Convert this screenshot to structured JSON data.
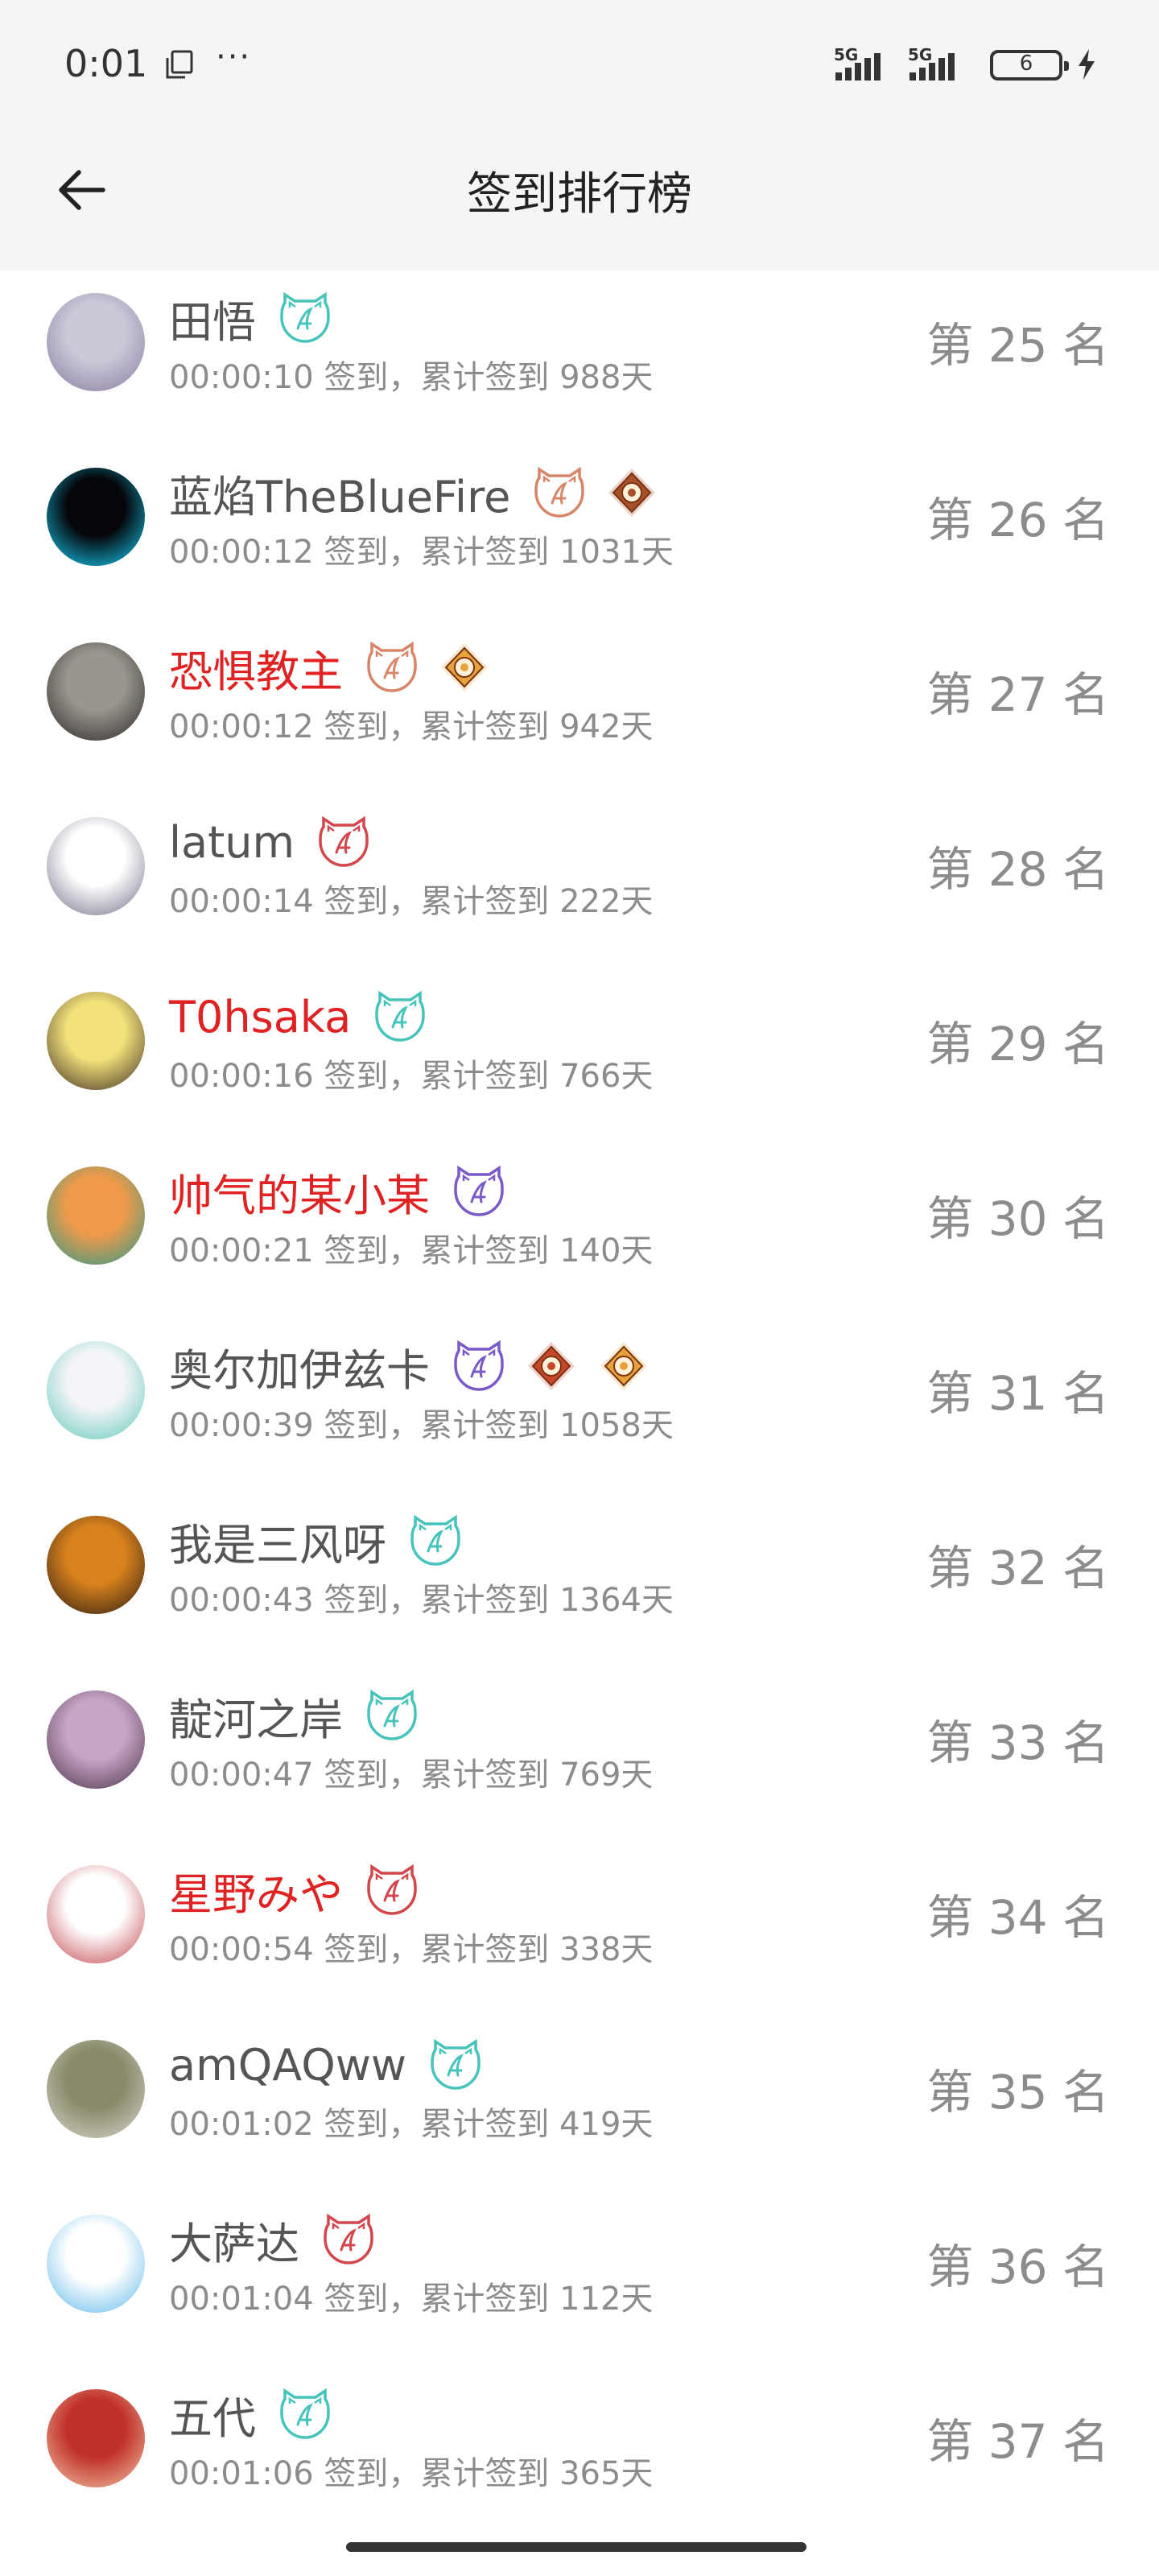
{
  "status": {
    "time": "0:01",
    "dots": "···",
    "sig1": "5G",
    "sig2": "5G",
    "battery": "6"
  },
  "header": {
    "title": "签到排行榜"
  },
  "rows": [
    {
      "name": "田悟",
      "red": false,
      "detail": "00:00:10 签到，累计签到 988天",
      "rank": "第 25 名",
      "badges": [
        "cat-cyan"
      ],
      "av": [
        "#c9c9d8",
        "#8a7aa0"
      ]
    },
    {
      "name": "蓝焰TheBlueFire",
      "red": false,
      "detail": "00:00:12 签到，累计签到 1031天",
      "rank": "第 26 名",
      "badges": [
        "cat-orange",
        "medal-brown"
      ],
      "av": [
        "#05060a",
        "#17d7ff"
      ]
    },
    {
      "name": "恐惧教主",
      "red": true,
      "detail": "00:00:12 签到，累计签到 942天",
      "rank": "第 27 名",
      "badges": [
        "cat-orange",
        "medal-gold"
      ],
      "av": [
        "#9a958e",
        "#2a2624"
      ]
    },
    {
      "name": "latum",
      "red": false,
      "detail": "00:00:14 签到，累计签到 222天",
      "rank": "第 28 名",
      "badges": [
        "cat-red"
      ],
      "av": [
        "#ffffff",
        "#6f6f86"
      ]
    },
    {
      "name": "T0hsaka",
      "red": true,
      "detail": "00:00:16 签到，累计签到 766天",
      "rank": "第 29 名",
      "badges": [
        "cat-cyan"
      ],
      "av": [
        "#f3e27a",
        "#3a2a22"
      ]
    },
    {
      "name": "帅气的某小某",
      "red": true,
      "detail": "00:00:21 签到，累计签到 140天",
      "rank": "第 30 名",
      "badges": [
        "cat-purple"
      ],
      "av": [
        "#ef9a4a",
        "#2a9a8a"
      ]
    },
    {
      "name": "奥尔加伊兹卡",
      "red": false,
      "detail": "00:00:39 签到，累计签到 1058天",
      "rank": "第 31 名",
      "badges": [
        "cat-purple",
        "medal-qing",
        "medal-gold"
      ],
      "av": [
        "#f2f4f7",
        "#5fc8b8"
      ]
    },
    {
      "name": "我是三风呀",
      "red": false,
      "detail": "00:00:43 签到，累计签到 1364天",
      "rank": "第 32 名",
      "badges": [
        "cat-cyan"
      ],
      "av": [
        "#d8821e",
        "#2a1a10"
      ]
    },
    {
      "name": "靛河之岸",
      "red": false,
      "detail": "00:00:47 签到，累计签到 769天",
      "rank": "第 33 名",
      "badges": [
        "cat-cyan"
      ],
      "av": [
        "#c8a6c8",
        "#4a3248"
      ]
    },
    {
      "name": "星野みや",
      "red": true,
      "detail": "00:00:54 签到，累计签到 338天",
      "rank": "第 34 名",
      "badges": [
        "cat-red"
      ],
      "av": [
        "#ffffff",
        "#c2434a"
      ]
    },
    {
      "name": "amQAQww",
      "red": false,
      "detail": "00:01:02 签到，累计签到 419天",
      "rank": "第 35 名",
      "badges": [
        "cat-cyan"
      ],
      "av": [
        "#8a8a6a",
        "#d8d6cc"
      ]
    },
    {
      "name": "大萨达",
      "red": false,
      "detail": "00:01:04 签到，累计签到 112天",
      "rank": "第 36 名",
      "badges": [
        "cat-red"
      ],
      "av": [
        "#ffffff",
        "#5cb8e8"
      ]
    },
    {
      "name": "五代",
      "red": false,
      "detail": "00:01:06 签到，累计签到 365天",
      "rank": "第 37 名",
      "badges": [
        "cat-cyan"
      ],
      "av": [
        "#c0302a",
        "#f2c8a8"
      ]
    }
  ],
  "badge_icons": {
    "cat-cyan": "cat-badge-cyan-icon",
    "cat-orange": "cat-badge-orange-icon",
    "cat-red": "cat-badge-red-icon",
    "cat-purple": "cat-badge-purple-icon",
    "medal-brown": "medal-brown-icon",
    "medal-gold": "medal-gold-icon",
    "medal-qing": "medal-qing-icon"
  },
  "colors": {
    "cat-cyan": "#46c4bc",
    "cat-orange": "#d8866a",
    "cat-red": "#d2464c",
    "cat-purple": "#7a5ac8",
    "medal-brown": "#a8502a",
    "medal-gold": "#e6a23c",
    "medal-qing": "#c8462a",
    "name_red": "#e02222"
  }
}
